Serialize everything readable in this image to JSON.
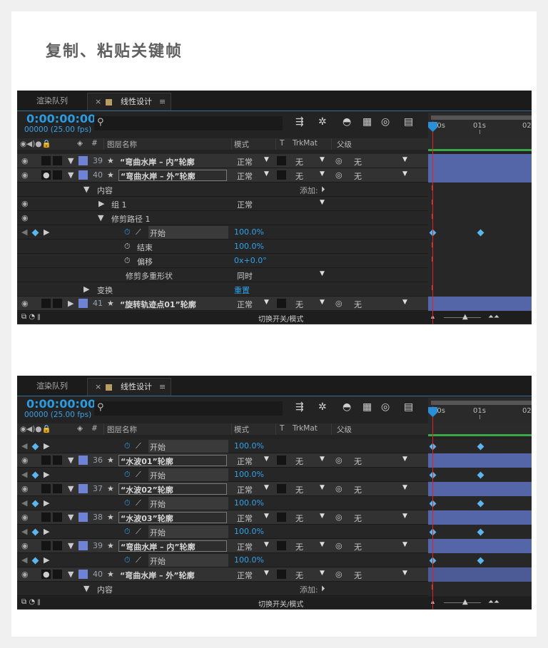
{
  "heading": "复制、粘贴关键帧",
  "tabs": {
    "render": "渲染队列",
    "close": "×",
    "comp": "线性设计",
    "menu": "≡"
  },
  "timecode": "0:00:00:00",
  "timecode_sub": "00000 (25.00 fps)",
  "ruler": {
    "t0": "00s",
    "t1": "01s",
    "t2": "02"
  },
  "columns": {
    "hash": "#",
    "name": "图层名称",
    "mode": "模式",
    "t": "T",
    "trkmat": "TrkMat",
    "parent": "父级"
  },
  "bottom_label": "切换开关/模式",
  "common": {
    "normal": "正常",
    "none": "无",
    "simultaneous": "同时",
    "start": "开始",
    "end": "结束",
    "offset": "偏移",
    "add": "添加:"
  },
  "panel1": {
    "layer39_num": "39",
    "layer39_name": "“弯曲水岸 – 内”轮廓",
    "layer40_num": "40",
    "layer40_name": "“弯曲水岸 – 外”轮廓",
    "content": "内容",
    "group": "组 1",
    "trim": "修剪路径 1",
    "start_val": "100.0%",
    "end_val": "100.0%",
    "offset_val": "0x+0.0°",
    "multi": "修剪多重形状",
    "transform": "变换",
    "reset": "重置",
    "layer41_num": "41",
    "layer41_name": "“旋转轨迹点01”轮廓"
  },
  "panel2": {
    "val": "100.0%",
    "layer36_num": "36",
    "layer36_name": "“水波01”轮廓",
    "layer37_num": "37",
    "layer37_name": "“水波02”轮廓",
    "layer38_num": "38",
    "layer38_name": "“水波03”轮廓",
    "layer39_num": "39",
    "layer39_name": "“弯曲水岸 – 内”轮廓",
    "layer40_num": "40",
    "layer40_name": "“弯曲水岸 – 外”轮廓",
    "content": "内容"
  }
}
